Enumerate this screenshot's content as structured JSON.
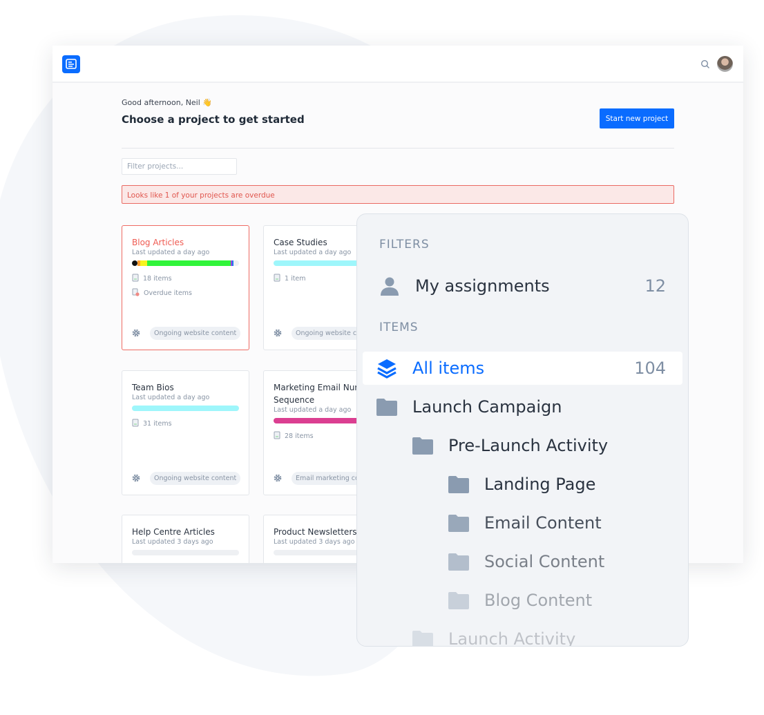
{
  "header": {
    "logo": "app-logo",
    "search_icon": "search-icon",
    "avatar": "user-avatar"
  },
  "greeting": "Good afternoon, Neil 👋",
  "title": "Choose a project to get started",
  "start_button": "Start new project",
  "filter": {
    "placeholder": "Filter projects...",
    "value": ""
  },
  "alert": "Looks like 1 of your projects are overdue",
  "projects": [
    {
      "name": "Blog Articles",
      "updated": "Last updated a day ago",
      "items": "18 items",
      "overdue": "Overdue items",
      "tag": "Ongoing website content",
      "overdue_flag": true,
      "progress": [
        {
          "color": "#111111",
          "pct": 5
        },
        {
          "color": "#ff9f2e",
          "pct": 3
        },
        {
          "color": "#f7f31f",
          "pct": 6
        },
        {
          "color": "#31f43a",
          "pct": 78
        },
        {
          "color": "#a43ee0",
          "pct": 1.5
        },
        {
          "color": "#1e7cf0",
          "pct": 1.5
        }
      ]
    },
    {
      "name": "Case Studies",
      "updated": "Last updated a day ago",
      "items": "1 item",
      "tag": "Ongoing website content",
      "progress": [
        {
          "color": "#9ef6fb",
          "pct": 100
        }
      ]
    },
    {
      "name": "Team Bios",
      "updated": "Last updated a day ago",
      "items": "31 items",
      "tag": "Ongoing website content",
      "progress": [
        {
          "color": "#9ef6fb",
          "pct": 100
        }
      ]
    },
    {
      "name": "Marketing Email Nurture Sequence",
      "updated": "Last updated a day ago",
      "items": "28 items",
      "tag": "Email marketing content",
      "progress": [
        {
          "color": "#db3f91",
          "pct": 100
        }
      ]
    },
    {
      "name": "Help Centre Articles",
      "updated": "Last updated 3 days ago",
      "progress": []
    },
    {
      "name": "Product Newsletters",
      "updated": "Last updated 3 days ago",
      "progress": []
    }
  ],
  "panel": {
    "filters_label": "FILTERS",
    "my_assignments": {
      "label": "My assignments",
      "count": "12"
    },
    "items_label": "ITEMS",
    "all_items": {
      "label": "All items",
      "count": "104"
    },
    "folders": [
      {
        "label": "Launch Campaign",
        "level": 0
      },
      {
        "label": "Pre-Launch Activity",
        "level": 1
      },
      {
        "label": "Landing Page",
        "level": 2
      },
      {
        "label": "Email Content",
        "level": 2
      },
      {
        "label": "Social Content",
        "level": 2
      },
      {
        "label": "Blog Content",
        "level": 2
      },
      {
        "label": "Launch Activity",
        "level": 1
      }
    ]
  },
  "colors": {
    "accent": "#0a6cff",
    "danger": "#ef5b52",
    "folder": "#8a9bb0"
  }
}
